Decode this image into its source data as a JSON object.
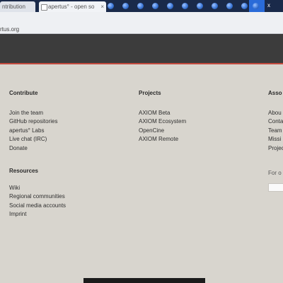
{
  "browser": {
    "tabs": [
      {
        "label": "ntribution",
        "active": false
      },
      {
        "label": "apertus° - open so",
        "active": true
      }
    ],
    "close_glyph": "×",
    "strip_text": "x",
    "address": "rtus.org"
  },
  "footer": {
    "contribute": {
      "heading": "Contribute",
      "links": [
        "Join the team",
        "GitHub repositories",
        "apertus° Labs",
        "Live chat (IRC)",
        "Donate"
      ]
    },
    "projects": {
      "heading": "Projects",
      "links": [
        "AXIOM Beta",
        "AXIOM Ecosystem",
        "OpenCine",
        "AXIOM Remote"
      ]
    },
    "association": {
      "heading": "Asso",
      "links": [
        "Abou",
        "Conta",
        "Team",
        "Missi",
        "Projec"
      ],
      "partial_text": "For o"
    },
    "resources": {
      "heading": "Resources",
      "links": [
        "Wiki",
        "Regional communities",
        "Social media accounts",
        "Imprint"
      ]
    }
  },
  "colors": {
    "page_bg": "#d8d5ce",
    "header_bg": "#3c3c3c",
    "accent_line": "#c24a3e",
    "tabstrip_bg": "#1a2a4a"
  }
}
